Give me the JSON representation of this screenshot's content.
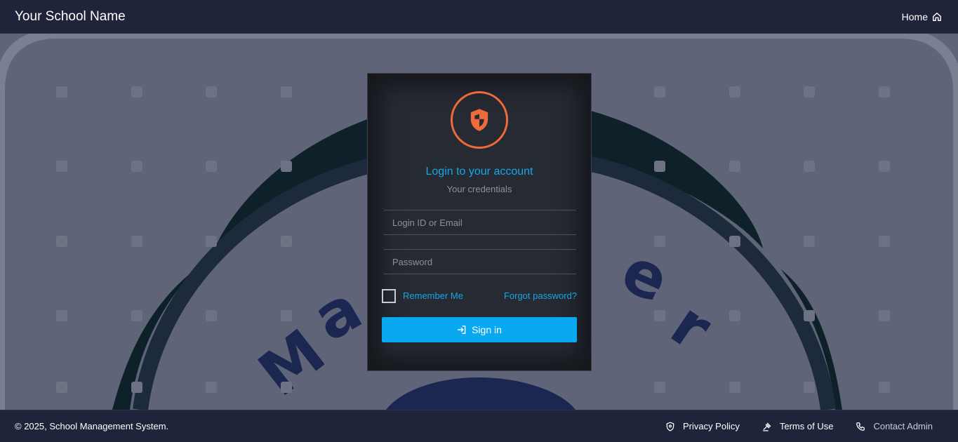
{
  "header": {
    "brand": "Your School Name",
    "home_label": "Home"
  },
  "login": {
    "title": "Login to your account",
    "subtitle": "Your credentials",
    "login_placeholder": "Login ID or Email",
    "login_value": "",
    "password_placeholder": "Password",
    "password_value": "",
    "remember_label": "Remember Me",
    "remember_checked": false,
    "forgot_label": "Forgot password?",
    "signin_label": "Sign in"
  },
  "footer": {
    "copyright": "© 2025,  School Management System.",
    "links": [
      {
        "label": "Privacy Policy",
        "icon": "shield-icon"
      },
      {
        "label": "Terms of Use",
        "icon": "gavel-icon"
      },
      {
        "label": "Contact Admin",
        "icon": "phone-icon"
      }
    ]
  },
  "colors": {
    "navbar": "#20243a",
    "accent": "#17a7e5",
    "logo": "#f06b3a",
    "button": "#0aa8f0"
  }
}
